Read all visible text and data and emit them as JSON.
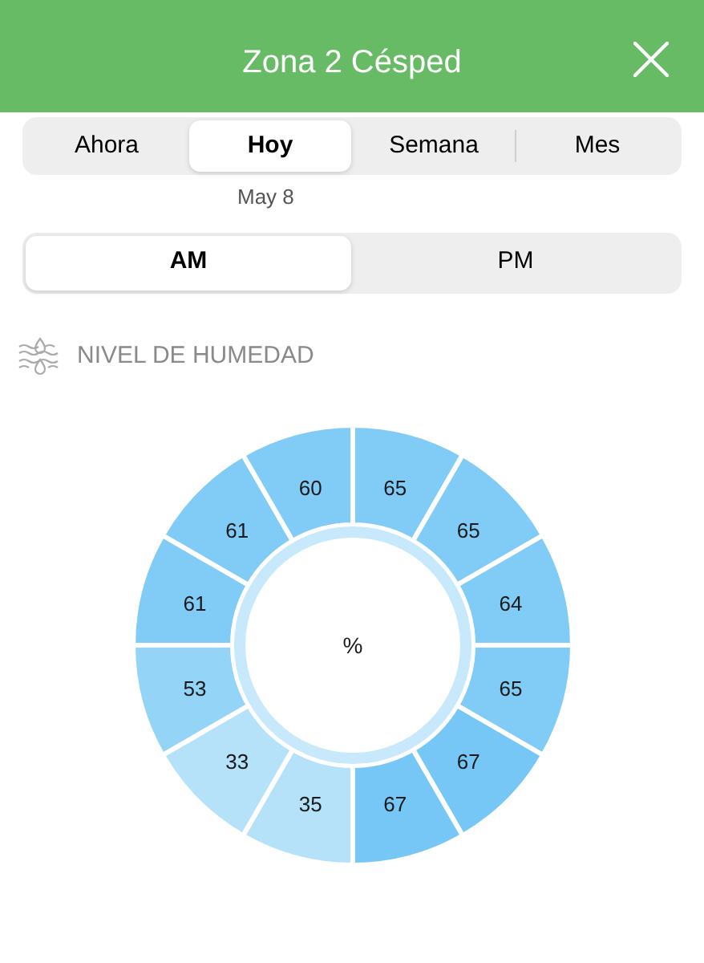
{
  "header": {
    "title": "Zona 2 Césped"
  },
  "period_tabs": [
    {
      "label": "Ahora",
      "selected": false
    },
    {
      "label": "Hoy",
      "selected": true
    },
    {
      "label": "Semana",
      "selected": false
    },
    {
      "label": "Mes",
      "selected": false
    }
  ],
  "date": "May 8",
  "half_day_tabs": [
    {
      "label": "AM",
      "selected": true
    },
    {
      "label": "PM",
      "selected": false
    }
  ],
  "section_title": "NIVEL DE HUMEDAD",
  "dial": {
    "unit": "%",
    "segments": [
      {
        "value": "65",
        "color": "#80ccf7"
      },
      {
        "value": "65",
        "color": "#80ccf7"
      },
      {
        "value": "64",
        "color": "#80ccf7"
      },
      {
        "value": "65",
        "color": "#80ccf7"
      },
      {
        "value": "67",
        "color": "#76c7f5"
      },
      {
        "value": "67",
        "color": "#76c7f5"
      },
      {
        "value": "35",
        "color": "#b5e1f9"
      },
      {
        "value": "33",
        "color": "#b5e1f9"
      },
      {
        "value": "53",
        "color": "#94d4f7"
      },
      {
        "value": "61",
        "color": "#80ccf7"
      },
      {
        "value": "61",
        "color": "#80ccf7"
      },
      {
        "value": "60",
        "color": "#80ccf7"
      }
    ]
  }
}
